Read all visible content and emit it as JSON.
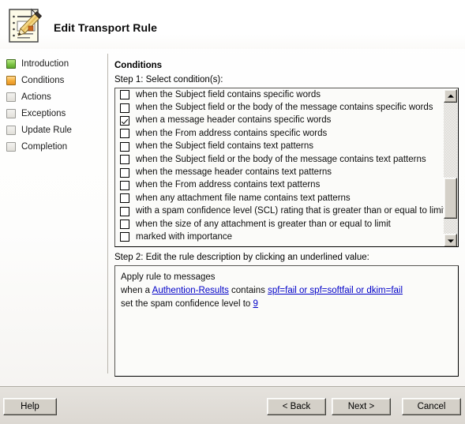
{
  "window": {
    "title": "Edit Transport Rule",
    "title_icon": "edit-rule-document-pencil-icon"
  },
  "sidebar": {
    "items": [
      {
        "label": "Introduction",
        "state": "done",
        "icon": "status-square-green-icon"
      },
      {
        "label": "Conditions",
        "state": "current",
        "icon": "status-square-orange-icon"
      },
      {
        "label": "Actions",
        "state": "pending",
        "icon": "status-square-gray-icon"
      },
      {
        "label": "Exceptions",
        "state": "pending",
        "icon": "status-square-gray-icon"
      },
      {
        "label": "Update Rule",
        "state": "pending",
        "icon": "status-square-gray-icon"
      },
      {
        "label": "Completion",
        "state": "pending",
        "icon": "status-square-gray-icon"
      }
    ]
  },
  "main": {
    "heading": "Conditions",
    "step1_label": "Step 1: Select condition(s):",
    "step2_label": "Step 2: Edit the rule description by clicking an underlined value:",
    "conditions": [
      {
        "text": "when the Subject field contains specific words",
        "checked": false
      },
      {
        "text": "when the Subject field or the body of the message contains specific words",
        "checked": false
      },
      {
        "text": "when a message header contains specific words",
        "checked": true
      },
      {
        "text": "when the From address contains specific words",
        "checked": false
      },
      {
        "text": "when the Subject field contains text patterns",
        "checked": false
      },
      {
        "text": "when the Subject field or the body of the message contains text patterns",
        "checked": false
      },
      {
        "text": "when the message header contains text patterns",
        "checked": false
      },
      {
        "text": "when the From address contains text patterns",
        "checked": false
      },
      {
        "text": "when any attachment file name contains text patterns",
        "checked": false
      },
      {
        "text": "with a spam confidence level (SCL) rating that is greater than or equal to limit",
        "checked": false
      },
      {
        "text": "when the size of any attachment is greater than or equal to limit",
        "checked": false
      },
      {
        "text": "marked with importance",
        "checked": false
      }
    ],
    "description": {
      "line1": "Apply rule to messages",
      "line2_pre": "when a ",
      "line2_link1": "Authention-Results",
      "line2_mid": " contains ",
      "line2_link2": "spf=fail or spf=softfail or dkim=fail",
      "line3_pre": "set the spam confidence level to ",
      "line3_link": "9"
    },
    "link_color": "#0000c8"
  },
  "footer": {
    "help": "Help",
    "back": "< Back",
    "next": "Next >",
    "cancel": "Cancel"
  }
}
